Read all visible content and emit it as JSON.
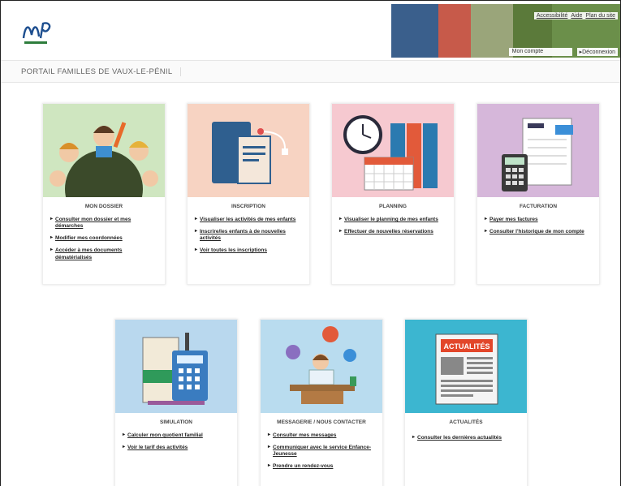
{
  "header": {
    "top_links": [
      "Accessibilité",
      "Aide",
      "Plan du site"
    ],
    "account_label": "Mon compte",
    "logout_label": "Déconnexion"
  },
  "page_title": "PORTAIL FAMILLES DE VAUX-LE-PÉNIL",
  "cards": [
    {
      "title": "MON DOSSIER",
      "links": [
        "Consulter mon dossier et mes démarches",
        "Modifier mes coordonnées",
        "Accéder à mes documents dématérialisés"
      ]
    },
    {
      "title": "INSCRIPTION",
      "links": [
        "Visualiser les activités de mes enfants",
        "Inscrire/les enfants à de nouvelles activités",
        "Voir toutes les inscriptions"
      ]
    },
    {
      "title": "PLANNING",
      "links": [
        "Visualiser le planning de mes enfants",
        "Effectuer de nouvelles réservations"
      ]
    },
    {
      "title": "FACTURATION",
      "links": [
        "Payer mes factures",
        "Consulter l'historique de mon compte"
      ]
    },
    {
      "title": "SIMULATION",
      "links": [
        "Calculer mon quotient familial",
        "Voir le tarif des activités"
      ]
    },
    {
      "title": "MESSAGERIE / NOUS CONTACTER",
      "links": [
        "Consulter mes messages",
        "Communiquer avec le service Enfance-Jeunesse",
        "Prendre un rendez-vous"
      ]
    },
    {
      "title": "ACTUALITÉS",
      "links": [
        "Consulter les dernières actualités"
      ]
    }
  ],
  "actualites_badge": "ACTUALITÉS",
  "colors": {
    "dossier_bg": "#cfe6c0",
    "inscription_bg": "#f7d3c2",
    "planning_bg": "#f6c9d0",
    "facturation_bg": "#d6b7da",
    "simulation_bg": "#b9d8ee",
    "messagerie_bg": "#b9dcef",
    "actualites_bg": "#3cb6d0"
  }
}
